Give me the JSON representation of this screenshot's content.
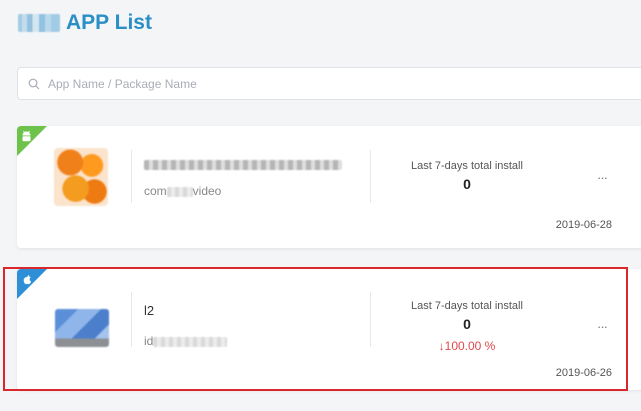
{
  "header": {
    "title": "APP List"
  },
  "search": {
    "placeholder": "App Name / Package Name"
  },
  "apps": [
    {
      "platform": "android",
      "name": "",
      "package_prefix": "com",
      "package_suffix": "video",
      "stat_label": "Last 7-days total install",
      "installs": "0",
      "change": "",
      "more": "···",
      "date": "2019-06-28"
    },
    {
      "platform": "ios",
      "name": "l2",
      "package_prefix": "id",
      "package_suffix": "",
      "stat_label": "Last 7-days total install",
      "installs": "0",
      "change": "↓100.00 %",
      "more": "···",
      "date": "2019-06-26"
    }
  ],
  "colors": {
    "accent": "#2a8fc6",
    "android": "#6cc24a",
    "ios": "#2f8fd6",
    "decrease": "#e0474d",
    "highlight": "#d9272b"
  }
}
